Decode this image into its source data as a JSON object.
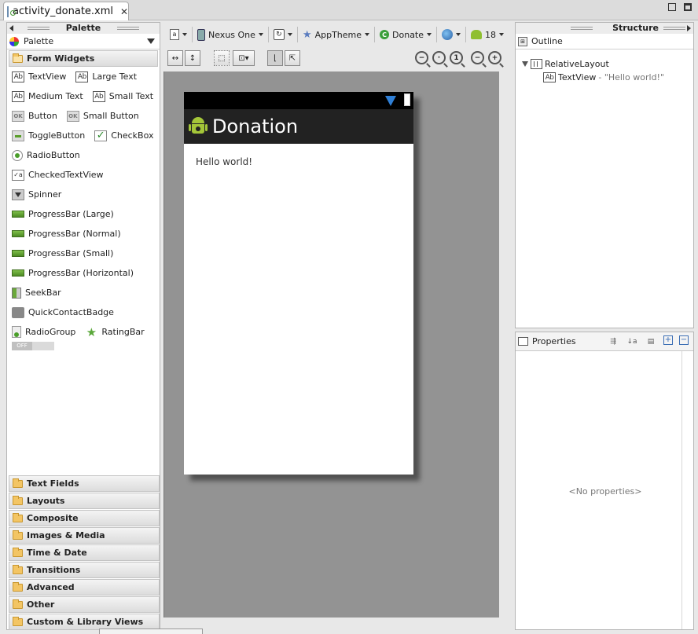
{
  "tab": {
    "title": "activity_donate.xml"
  },
  "palette": {
    "panel_title": "Palette",
    "selector": "Palette",
    "open_category": "Form Widgets",
    "rows": [
      [
        {
          "label": "TextView",
          "icon": "ab-icon"
        },
        {
          "label": "Large Text",
          "icon": "ab-icon"
        }
      ],
      [
        {
          "label": "Medium Text",
          "icon": "ab-icon"
        },
        {
          "label": "Small Text",
          "icon": "ab-icon"
        }
      ],
      [
        {
          "label": "Button",
          "icon": "ok-button-icon"
        },
        {
          "label": "Small Button",
          "icon": "ok-button-icon"
        }
      ],
      [
        {
          "label": "ToggleButton",
          "icon": "toggle-icon"
        },
        {
          "label": "CheckBox",
          "icon": "checkbox-icon"
        }
      ],
      [
        {
          "label": "RadioButton",
          "icon": "radio-icon"
        }
      ],
      [
        {
          "label": "CheckedTextView",
          "icon": "checked-text-icon"
        }
      ],
      [
        {
          "label": "Spinner",
          "icon": "spinner-icon"
        }
      ],
      [
        {
          "label": "ProgressBar (Large)",
          "icon": "progress-icon"
        }
      ],
      [
        {
          "label": "ProgressBar (Normal)",
          "icon": "progress-icon"
        }
      ],
      [
        {
          "label": "ProgressBar (Small)",
          "icon": "progress-icon"
        }
      ],
      [
        {
          "label": "ProgressBar (Horizontal)",
          "icon": "progress-icon"
        }
      ],
      [
        {
          "label": "SeekBar",
          "icon": "seekbar-icon"
        }
      ],
      [
        {
          "label": "QuickContactBadge",
          "icon": "badge-icon"
        }
      ],
      [
        {
          "label": "RadioGroup",
          "icon": "radiogroup-icon"
        },
        {
          "label": "RatingBar",
          "icon": "star-icon"
        }
      ]
    ],
    "switch_off": "OFF",
    "categories": [
      "Text Fields",
      "Layouts",
      "Composite",
      "Images & Media",
      "Time & Date",
      "Transitions",
      "Advanced",
      "Other",
      "Custom & Library Views"
    ]
  },
  "toolbar": {
    "device": "Nexus One",
    "theme": "AppTheme",
    "activity": "Donate",
    "api": "18"
  },
  "device_preview": {
    "app_title": "Donation",
    "hello_text": "Hello world!"
  },
  "structure": {
    "panel_title": "Structure",
    "outline_label": "Outline",
    "root_node": "RelativeLayout",
    "child_node": "TextView",
    "child_value": "- \"Hello world!\""
  },
  "properties": {
    "title": "Properties",
    "empty_text": "<No properties>"
  },
  "colors": {
    "accent_green": "#a4c639",
    "action_bar": "#222222",
    "canvas_gray": "#939393"
  }
}
